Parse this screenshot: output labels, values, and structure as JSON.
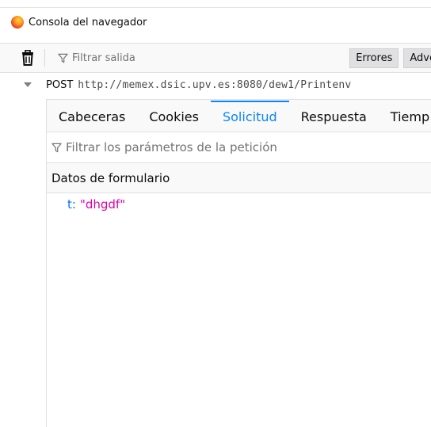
{
  "window": {
    "title": "Consola del navegador"
  },
  "toolbar": {
    "filter_placeholder": "Filtrar salida",
    "buttons": [
      "Errores",
      "Adve"
    ]
  },
  "request": {
    "method": "POST",
    "url": "http://memex.dsic.upv.es:8080/dew1/Printenv"
  },
  "tabs": [
    {
      "label": "Cabeceras",
      "active": false
    },
    {
      "label": "Cookies",
      "active": false
    },
    {
      "label": "Solicitud",
      "active": true
    },
    {
      "label": "Respuesta",
      "active": false
    },
    {
      "label": "Tiemp",
      "active": false
    }
  ],
  "params_filter_placeholder": "Filtrar los parámetros de la petición",
  "form_section": {
    "title": "Datos de formulario",
    "params": [
      {
        "key": "t",
        "value": "\"dhgdf\""
      }
    ]
  },
  "colors": {
    "accent": "#0a84ff",
    "key": "#0074e8",
    "string_value": "#dd00a9"
  },
  "icons": [
    "firefox-logo-icon",
    "trash-icon",
    "funnel-icon",
    "caret-down-icon"
  ]
}
